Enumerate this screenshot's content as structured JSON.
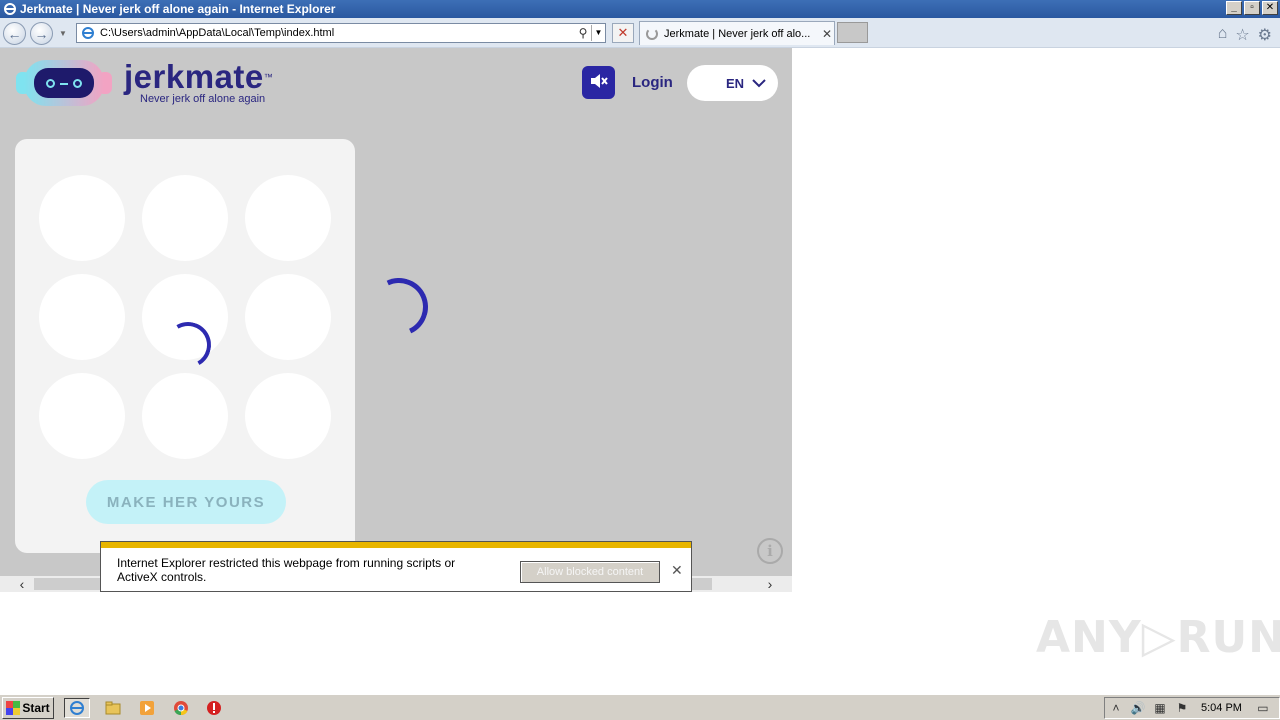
{
  "window": {
    "title": "Jerkmate | Never jerk off alone again - Internet Explorer",
    "controls": {
      "minimize": "_",
      "restore": "▫",
      "close": "✕"
    }
  },
  "nav": {
    "url": "C:\\Users\\admin\\AppData\\Local\\Temp\\index.html",
    "tab_label": "Jerkmate | Never jerk off alo...",
    "tab_close": "✕",
    "stop": "✕"
  },
  "page": {
    "brand_name": "jerkmate",
    "brand_tm": "™",
    "brand_tagline": "Never jerk off alone again",
    "login_label": "Login",
    "language": "EN",
    "cta_label": "MAKE HER YOURS",
    "info_glyph": "i"
  },
  "infobar": {
    "message": "Internet Explorer restricted this webpage from running scripts or ActiveX controls.",
    "allow_button": "Allow blocked content",
    "close": "✕"
  },
  "watermark": "ANY▷RUN",
  "taskbar": {
    "start_label": "Start",
    "clock": "5:04 PM"
  },
  "colors": {
    "brand": "#2a2680",
    "accent": "#2d2ab0",
    "cta_bg": "#c4f2f8",
    "infobar_strip": "#e8b500"
  }
}
